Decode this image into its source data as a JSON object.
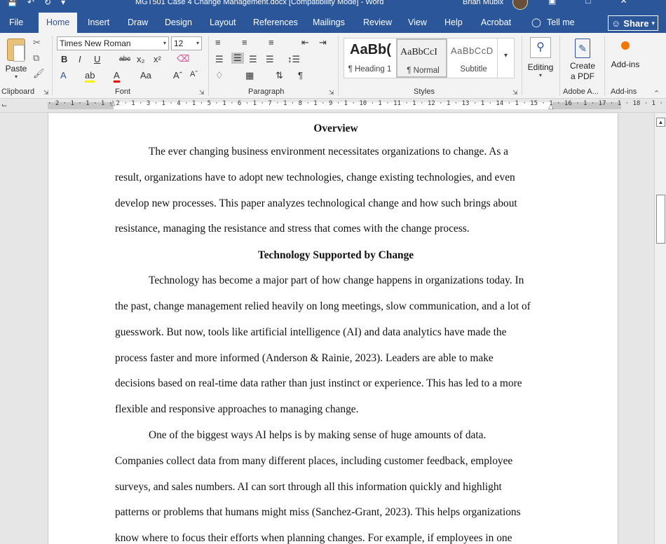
{
  "titlebar": {
    "title": "MGT501 Case 4 Change Management.docx [Compatibility Mode]  -  Word",
    "user": "Brian Mubix",
    "qat_icons": [
      "save-icon",
      "undo-icon",
      "redo-icon",
      "customize-icon"
    ]
  },
  "tabs": [
    {
      "label": "File"
    },
    {
      "label": "Home"
    },
    {
      "label": "Insert"
    },
    {
      "label": "Draw"
    },
    {
      "label": "Design"
    },
    {
      "label": "Layout"
    },
    {
      "label": "References"
    },
    {
      "label": "Mailings"
    },
    {
      "label": "Review"
    },
    {
      "label": "View"
    },
    {
      "label": "Help"
    },
    {
      "label": "Acrobat"
    }
  ],
  "tellme": "Tell me",
  "share": "Share",
  "ribbon": {
    "clipboard": {
      "paste": "Paste",
      "label": "Clipboard"
    },
    "font": {
      "name": "Times New Roman",
      "size": "12",
      "label": "Font"
    },
    "paragraph": {
      "label": "Paragraph"
    },
    "styles": {
      "label": "Styles",
      "items": [
        {
          "sample": "AaBb(",
          "name": "¶ Heading 1"
        },
        {
          "sample": "AaBbCcI",
          "name": "¶ Normal"
        },
        {
          "sample": "AaBbCcD",
          "name": "Subtitle"
        }
      ]
    },
    "editing": {
      "label": "Editing"
    },
    "adobe": {
      "label": "Create a PDF",
      "line1": "Create",
      "line2": "a PDF",
      "group": "Adobe A..."
    },
    "addins": {
      "label": "Add-ins",
      "group": "Add-ins"
    }
  },
  "ruler": {
    "numbers": "· 2 · 1 · 1 · 1 · 2 · 1 · 3 · 1 · 4 · 1 · 5 · 1 · 6 · 1 · 7 · 1 · 8 · 1 · 9 · 1 · 10 · 1 · 11 · 1 · 12 · 1 · 13 · 1 · 14 · 1 · 15 · 1 · 16 · 1 · 17 · 1 · 18 · 1 · 19"
  },
  "document": {
    "heading1": "Overview",
    "para1": [
      "The ever changing business environment necessitates organizations to change. As a",
      "result, organizations have to adopt new technologies, change existing technologies, and even",
      "develop new processes. This paper analyzes technological change and how such brings about",
      "resistance, managing the resistance and stress that comes with the change process."
    ],
    "heading2": "Technology Supported by Change",
    "para2": [
      "Technology has become a major part of how change happens in organizations today. In",
      "the past, change management relied heavily on long meetings, slow communication, and a lot of",
      "guesswork. But now, tools like artificial intelligence (AI) and data analytics have made the",
      "process faster and more informed (Anderson & Rainie, 2023). Leaders are able to make",
      "decisions based on real-time data rather than just instinct or experience. This has led to a more",
      "flexible and responsive approaches to managing change."
    ],
    "para3": [
      "One of the biggest ways AI helps is by making sense of huge amounts of data.",
      "Companies collect data from many different places, including customer feedback, employee",
      "surveys, and sales numbers. AI can sort through all this information quickly and highlight",
      "patterns or problems that humans might miss (Sanchez-Grant, 2023). This helps organizations",
      "know where to focus their efforts when planning changes. For example, if employees in one"
    ]
  }
}
